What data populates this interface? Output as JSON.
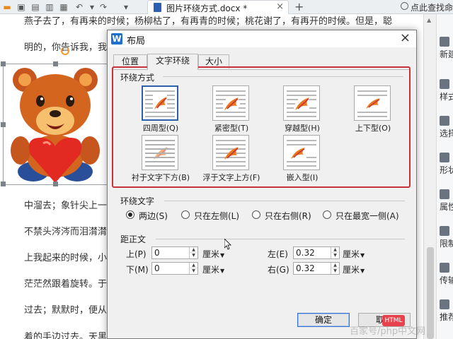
{
  "app": {
    "doc_tab_title": "图片环绕方式.docx *",
    "search_hint": "点此查找命",
    "new_tab_symbol": "+"
  },
  "document": {
    "lines": [
      "燕子去了，有再来的时候；杨柳枯了，有再青的时候；桃花谢了，有再开的时候。但是，聪",
      "明的，你告诉我，我们",
      "中溜去；象针尖上一滴",
      "不禁头涔涔而泪潸潸了",
      "上我起来的时候，小屋",
      "茫茫然跟着旋转。于是",
      "过去；默默时，便从凝",
      "着的手边过去。天黑时，我躺在床上，他便伶伶俐俐地从我"
    ]
  },
  "right_panel": {
    "items": [
      "新建",
      "样式",
      "选择",
      "形状",
      "属性",
      "限制",
      "传输",
      "推荐"
    ]
  },
  "dialog": {
    "title": "布局",
    "close_symbol": "×",
    "tabs": [
      {
        "label": "位置",
        "active": false
      },
      {
        "label": "文字环绕",
        "active": true
      },
      {
        "label": "大小",
        "active": false
      }
    ],
    "wrap_section_label": "环绕方式",
    "wrap_options": [
      {
        "label": "四周型(Q)",
        "selected": true
      },
      {
        "label": "紧密型(T)",
        "selected": false
      },
      {
        "label": "穿越型(H)",
        "selected": false
      },
      {
        "label": "上下型(O)",
        "selected": false
      },
      {
        "label": "衬于文字下方(B)",
        "selected": false
      },
      {
        "label": "浮于文字上方(F)",
        "selected": false
      },
      {
        "label": "嵌入型(I)",
        "selected": false
      }
    ],
    "wrap_text_section_label": "环绕文字",
    "wrap_text_options": [
      {
        "label": "两边(S)",
        "checked": true
      },
      {
        "label": "只在左侧(L)",
        "checked": false
      },
      {
        "label": "只在右侧(R)",
        "checked": false
      },
      {
        "label": "只在最宽一侧(A)",
        "checked": false
      }
    ],
    "distance_section_label": "距正文",
    "distance": {
      "top": {
        "label": "上(P)",
        "value": "0",
        "unit": "厘米"
      },
      "bottom": {
        "label": "下(M)",
        "value": "0",
        "unit": "厘米"
      },
      "left": {
        "label": "左(E)",
        "value": "0.32",
        "unit": "厘米"
      },
      "right": {
        "label": "右(G)",
        "value": "0.32",
        "unit": "厘米"
      }
    },
    "ok_label": "确定",
    "cancel_label": "取消"
  },
  "watermark": {
    "logo_text": "HTML",
    "text": "百家号/php中文网"
  },
  "colors": {
    "highlight_border": "#c8323b",
    "selected_option_border": "#2e5fa8",
    "logo_blue": "#1f6fd0"
  }
}
